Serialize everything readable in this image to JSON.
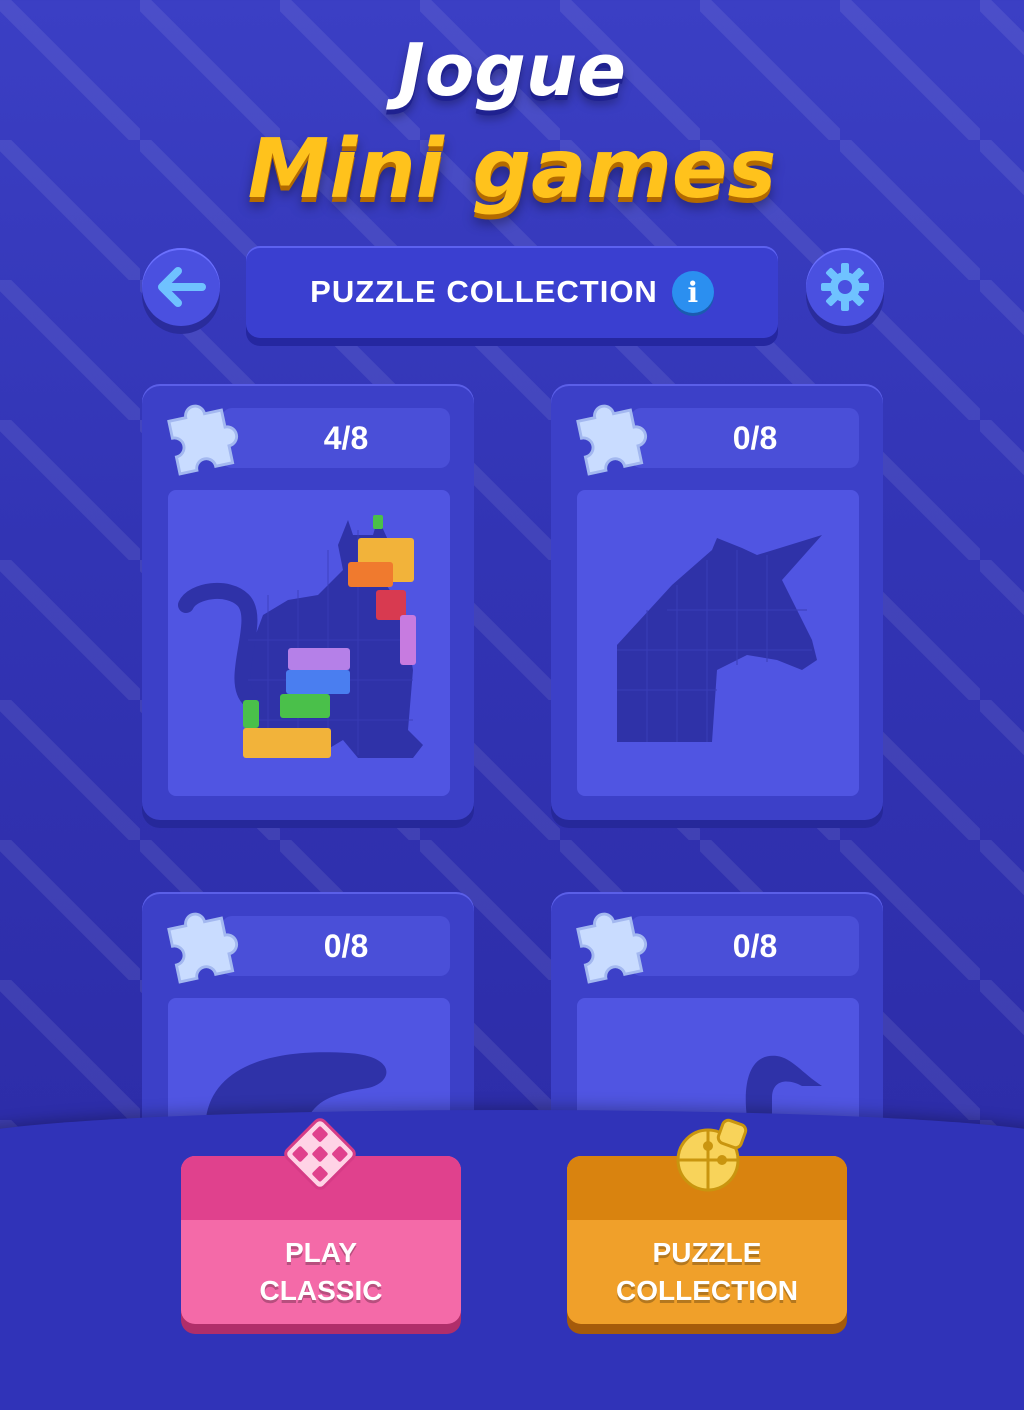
{
  "headline": {
    "line1": "Jogue",
    "line2": "Mini games"
  },
  "header": {
    "title": "PUZZLE COLLECTION",
    "info_icon": "info-icon",
    "back_icon": "arrow-left-icon",
    "settings_icon": "gear-icon"
  },
  "cards": [
    {
      "progress": "4/8",
      "silhouette": "cat"
    },
    {
      "progress": "0/8",
      "silhouette": "unicorn"
    },
    {
      "progress": "0/8",
      "silhouette": "beaver"
    },
    {
      "progress": "0/8",
      "silhouette": "swan"
    }
  ],
  "actions": {
    "classic_line1": "PLAY",
    "classic_line2": "CLASSIC",
    "collection_line1": "PUZZLE",
    "collection_line2": "COLLECTION"
  },
  "colors": {
    "background": "#3234b4",
    "accent_yellow": "#ffc21c",
    "classic_pink": "#f46aa8",
    "collection_orange": "#f0a02a"
  }
}
